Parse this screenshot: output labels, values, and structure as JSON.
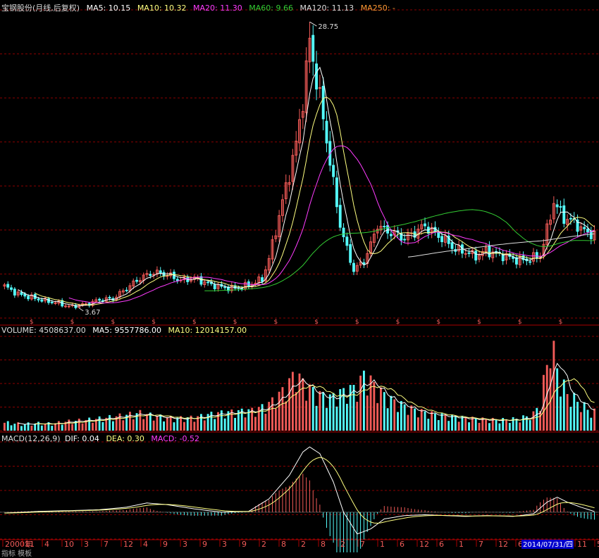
{
  "colors": {
    "background": "#000000",
    "up": "#f35b58",
    "down": "#54fcfc",
    "ma5": "#ffffff",
    "ma10": "#ffff80",
    "ma20": "#ff3cff",
    "ma60": "#33cc33",
    "ma120": "#dddddd",
    "ma250": "#ff9933",
    "grid": "#8b0000",
    "axis": "#aa0000",
    "date_highlight": "#0000cc"
  },
  "price_panel": {
    "title": "宝钢股份(月线,后复权)",
    "ma_labels": [
      {
        "key": "ma5",
        "text": "MA5: 10.15"
      },
      {
        "key": "ma10",
        "text": "MA10: 10.32"
      },
      {
        "key": "ma20",
        "text": "MA20: 11.30"
      },
      {
        "key": "ma60",
        "text": "MA60: 9.66"
      },
      {
        "key": "ma120",
        "text": "MA120: 11.13"
      },
      {
        "key": "ma250",
        "text": "MA250: -"
      }
    ],
    "high_label": "28.75",
    "low_label": "3.67",
    "dividend_marker": "$"
  },
  "volume_panel": {
    "labels": [
      {
        "key": "volume",
        "text": "VOLUME: 4508637.00"
      },
      {
        "key": "ma5",
        "text": "MA5: 9557786.00"
      },
      {
        "key": "ma10",
        "text": "MA10: 12014157.00"
      }
    ]
  },
  "macd_panel": {
    "labels": [
      {
        "key": "name",
        "text": "MACD(12,26,9)"
      },
      {
        "key": "dif",
        "text": "DIF: 0.04"
      },
      {
        "key": "dea",
        "text": "DEA: 0.30"
      },
      {
        "key": "macd",
        "text": "MACD: -0.52"
      }
    ]
  },
  "x_axis": {
    "labels": [
      "2000年",
      "11",
      "4",
      "10",
      "3",
      "7",
      "12",
      "4",
      "9",
      "3",
      "9",
      "3",
      "9",
      "2",
      "8",
      "2",
      "8",
      "2",
      "7",
      "1",
      "6",
      "12",
      "6",
      "1",
      "7",
      "12",
      "6",
      "12",
      "5",
      "11",
      "5"
    ],
    "highlight_date": "2014/07/31/四",
    "bottom_text": "指标  模板"
  },
  "chart_data": {
    "type": "candlestick",
    "title": "宝钢股份(月线,后复权)",
    "period": "monthly",
    "x": {
      "start": "2000-12",
      "end": "2015-05"
    },
    "ylim": [
      2.8,
      29.8
    ],
    "high_point": 28.75,
    "low_point": 3.67,
    "close_anchors": [
      [
        0,
        5.6
      ],
      [
        4,
        4.9
      ],
      [
        8,
        4.6
      ],
      [
        12,
        4.3
      ],
      [
        16,
        4.1
      ],
      [
        19,
        3.8
      ],
      [
        24,
        4.0
      ],
      [
        28,
        4.4
      ],
      [
        32,
        4.5
      ],
      [
        36,
        5.4
      ],
      [
        40,
        6.3
      ],
      [
        44,
        6.8
      ],
      [
        48,
        6.6
      ],
      [
        52,
        6.1
      ],
      [
        56,
        6.3
      ],
      [
        60,
        5.8
      ],
      [
        64,
        5.5
      ],
      [
        68,
        5.4
      ],
      [
        72,
        5.7
      ],
      [
        76,
        6.2
      ],
      [
        78,
        8.0
      ],
      [
        80,
        10.5
      ],
      [
        82,
        13.0
      ],
      [
        84,
        15.5
      ],
      [
        86,
        18.0
      ],
      [
        88,
        22.0
      ],
      [
        89,
        24.5
      ],
      [
        90,
        27.0
      ],
      [
        91,
        25.5
      ],
      [
        93,
        22.0
      ],
      [
        95,
        18.5
      ],
      [
        97,
        14.5
      ],
      [
        99,
        11.0
      ],
      [
        101,
        8.8
      ],
      [
        103,
        7.0
      ],
      [
        106,
        7.8
      ],
      [
        108,
        9.2
      ],
      [
        110,
        11.0
      ],
      [
        112,
        10.5
      ],
      [
        115,
        10.2
      ],
      [
        118,
        9.8
      ],
      [
        121,
        10.3
      ],
      [
        124,
        10.9
      ],
      [
        127,
        10.2
      ],
      [
        130,
        9.6
      ],
      [
        133,
        8.8
      ],
      [
        136,
        8.6
      ],
      [
        139,
        8.2
      ],
      [
        142,
        8.7
      ],
      [
        145,
        8.4
      ],
      [
        148,
        8.2
      ],
      [
        151,
        7.9
      ],
      [
        154,
        7.9
      ],
      [
        158,
        8.3
      ],
      [
        160,
        10.5
      ],
      [
        162,
        13.0
      ],
      [
        163,
        12.5
      ],
      [
        165,
        11.6
      ],
      [
        168,
        11.2
      ],
      [
        171,
        10.4
      ],
      [
        173,
        10.2
      ],
      [
        174,
        10.15
      ]
    ],
    "up_color": "#f35b58",
    "down_color": "#54fcfc",
    "moving_averages": [
      {
        "name": "MA5",
        "value": 10.15
      },
      {
        "name": "MA10",
        "value": 10.32
      },
      {
        "name": "MA20",
        "value": 11.3
      },
      {
        "name": "MA60",
        "value": 9.66
      },
      {
        "name": "MA120",
        "value": 11.13
      },
      {
        "name": "MA250",
        "value": null
      }
    ],
    "volume": {
      "last": 4508637.0,
      "ma5": 9557786.0,
      "ma10": 12014157.0,
      "anchors": [
        [
          0,
          2.0
        ],
        [
          5,
          1.6
        ],
        [
          10,
          1.8
        ],
        [
          14,
          1.7
        ],
        [
          18,
          2.2
        ],
        [
          24,
          2.6
        ],
        [
          30,
          3.1
        ],
        [
          36,
          3.8
        ],
        [
          40,
          4.3
        ],
        [
          44,
          3.6
        ],
        [
          50,
          3.0
        ],
        [
          56,
          3.2
        ],
        [
          62,
          4.2
        ],
        [
          68,
          4.6
        ],
        [
          74,
          5.0
        ],
        [
          78,
          6.5
        ],
        [
          82,
          9.5
        ],
        [
          86,
          14.0
        ],
        [
          88,
          11.5
        ],
        [
          92,
          9.0
        ],
        [
          96,
          8.0
        ],
        [
          100,
          9.5
        ],
        [
          104,
          10.5
        ],
        [
          106,
          13.5
        ],
        [
          108,
          12.0
        ],
        [
          110,
          10.0
        ],
        [
          114,
          7.5
        ],
        [
          118,
          6.0
        ],
        [
          122,
          4.8
        ],
        [
          128,
          3.8
        ],
        [
          134,
          3.2
        ],
        [
          140,
          2.8
        ],
        [
          146,
          2.6
        ],
        [
          152,
          2.9
        ],
        [
          156,
          4.0
        ],
        [
          158,
          7.0
        ],
        [
          160,
          16.0
        ],
        [
          161,
          22.0
        ],
        [
          162,
          18.5
        ],
        [
          164,
          12.0
        ],
        [
          166,
          9.0
        ],
        [
          170,
          6.5
        ],
        [
          173,
          4.5
        ],
        [
          174,
          4.5
        ]
      ]
    },
    "macd": {
      "params": "12,26,9",
      "dif": 0.04,
      "dea": 0.3,
      "macd": -0.52,
      "dif_anchors": [
        [
          0,
          -0.05
        ],
        [
          10,
          0.05
        ],
        [
          20,
          0.1
        ],
        [
          28,
          0.15
        ],
        [
          36,
          0.3
        ],
        [
          42,
          0.55
        ],
        [
          48,
          0.45
        ],
        [
          56,
          0.2
        ],
        [
          64,
          0.0
        ],
        [
          72,
          0.05
        ],
        [
          78,
          0.8
        ],
        [
          84,
          2.2
        ],
        [
          88,
          3.6
        ],
        [
          90,
          3.9
        ],
        [
          93,
          3.5
        ],
        [
          97,
          1.8
        ],
        [
          100,
          0.0
        ],
        [
          104,
          -1.3
        ],
        [
          108,
          -1.0
        ],
        [
          112,
          -0.4
        ],
        [
          118,
          -0.2
        ],
        [
          124,
          -0.15
        ],
        [
          130,
          -0.2
        ],
        [
          136,
          -0.25
        ],
        [
          142,
          -0.2
        ],
        [
          150,
          -0.25
        ],
        [
          156,
          -0.1
        ],
        [
          160,
          0.6
        ],
        [
          163,
          0.9
        ],
        [
          166,
          0.6
        ],
        [
          170,
          0.3
        ],
        [
          174,
          0.04
        ]
      ]
    },
    "x_tick_labels": [
      "2000年",
      "11",
      "4",
      "10",
      "3",
      "7",
      "12",
      "4",
      "9",
      "3",
      "9",
      "3",
      "9",
      "2",
      "8",
      "2",
      "8",
      "2",
      "7",
      "1",
      "6",
      "12",
      "6",
      "1",
      "7",
      "12",
      "6",
      "12",
      "5",
      "11",
      "5"
    ]
  }
}
